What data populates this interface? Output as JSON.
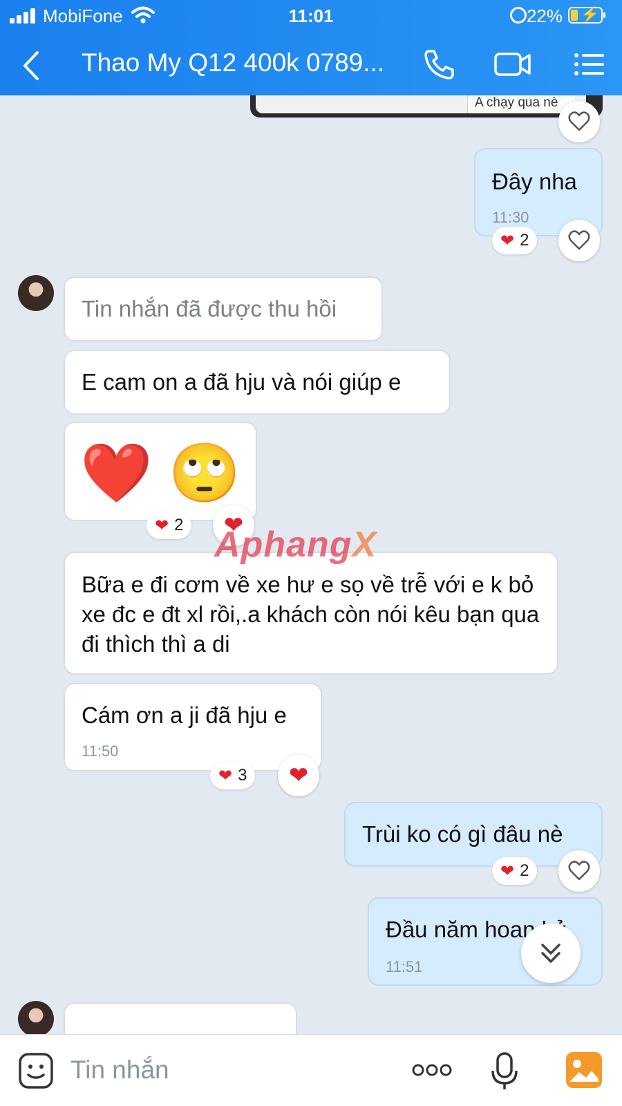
{
  "status": {
    "carrier": "MobiFone",
    "time": "11:01",
    "battery": "22%"
  },
  "header": {
    "title": "Thao My Q12 400k 0789..."
  },
  "messages": {
    "top_image_caption": "A chạy qua nè",
    "m1": {
      "text": "Đây nha",
      "time": "11:30",
      "react_count": "2"
    },
    "m2": {
      "text": "Tin nhắn đã được thu hồi"
    },
    "m3": {
      "text": "E cam on a đã hju và nói giúp e"
    },
    "m4": {
      "emoji": "❤️ 🙄",
      "react_count": "2"
    },
    "m5": {
      "text": "Bữa e đi cơm về xe hư e sọ về trễ với e k bỏ xe đc e đt xl rồi,.a khách còn nói kêu bạn qua đi thìch thì a di"
    },
    "m6": {
      "text": "Cám ơn a ji đã hju e",
      "time": "11:50",
      "react_count": "3"
    },
    "m7": {
      "text": "Trùi ko có gì đâu nè",
      "react_count": "2"
    },
    "m8": {
      "text": "Đầu năm hoan hỷ",
      "time": "11:51"
    }
  },
  "watermark": {
    "a": "Aphang",
    "b": "X"
  },
  "composer": {
    "placeholder": "Tin nhắn"
  },
  "colors": {
    "header": "#1a80ee",
    "chat_bg": "#e2e9f1",
    "outgoing": "#d4ecfd",
    "heart": "#e0222e"
  }
}
